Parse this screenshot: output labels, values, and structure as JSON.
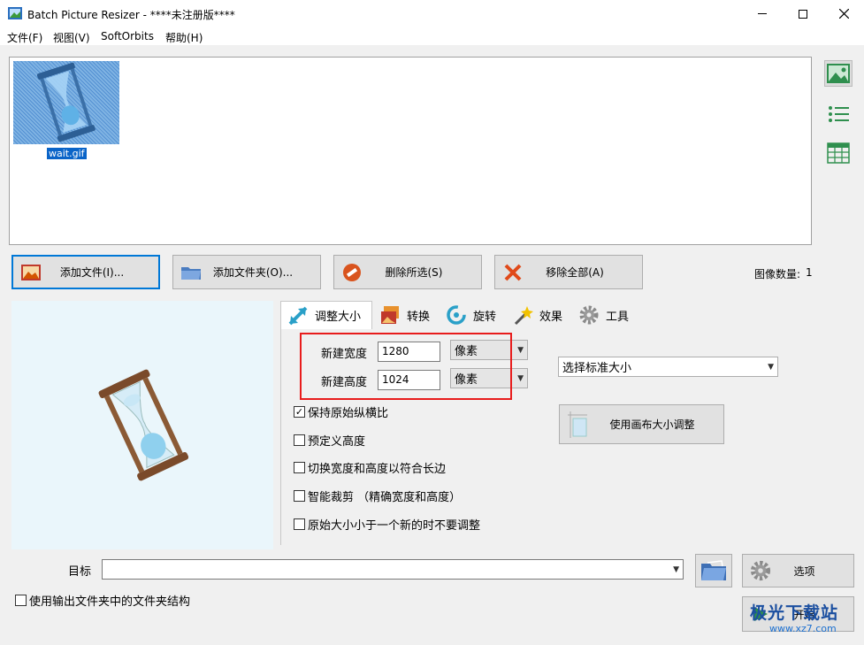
{
  "window": {
    "title": "Batch Picture Resizer - ****未注册版****",
    "controls": [
      "—",
      "☐",
      "✕"
    ]
  },
  "menu": [
    "文件(F)",
    "视图(V)",
    "SoftOrbits",
    "帮助(H)"
  ],
  "files": [
    {
      "name": "wait.gif"
    }
  ],
  "toolbar": {
    "add_files": "添加文件(I)...",
    "add_folder": "添加文件夹(O)...",
    "remove_selected": "删除所选(S)",
    "remove_all": "移除全部(A)",
    "image_count_label": "图像数量:",
    "image_count": "1"
  },
  "tabs": [
    "调整大小",
    "转换",
    "旋转",
    "效果",
    "工具"
  ],
  "resize": {
    "width_label": "新建宽度",
    "width_value": "1280",
    "width_unit": "像素",
    "height_label": "新建高度",
    "height_value": "1024",
    "height_unit": "像素",
    "standard_size": "选择标准大小",
    "canvas_button": "使用画布大小调整",
    "options": [
      {
        "label": "保持原始纵横比",
        "checked": true
      },
      {
        "label": "预定义高度",
        "checked": false
      },
      {
        "label": "切换宽度和高度以符合长边",
        "checked": false
      },
      {
        "label": "智能裁剪 （精确宽度和高度）",
        "checked": false
      },
      {
        "label": "原始大小小于一个新的时不要调整",
        "checked": false
      }
    ]
  },
  "destination": {
    "label": "目标",
    "value": "",
    "options_button": "选项",
    "keep_structure": "使用输出文件夹中的文件夹结构",
    "start_button": "开始"
  },
  "watermark": {
    "text": "极光下载站",
    "url": "www.xz7.com"
  },
  "colors": {
    "accent": "#0078d7",
    "highlight_box": "#e81c1c",
    "selection": "#0a64c8"
  }
}
